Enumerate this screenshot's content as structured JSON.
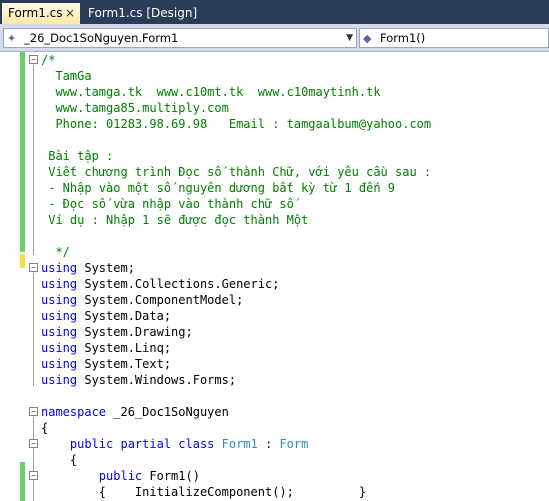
{
  "tabs": [
    {
      "label": "Form1.cs",
      "close": "×"
    },
    {
      "label": "Form1.cs [Design]"
    }
  ],
  "nav": {
    "left_combo": "_26_Doc1SoNguyen.Form1",
    "right_combo": "Form1()"
  },
  "code": {
    "comment": [
      "/*",
      "  TamGa",
      "  www.tamga.tk  www.c10mt.tk  www.c10maytinh.tk",
      "  www.tamga85.multiply.com",
      "  Phone: 01283.98.69.98   Email : tamgaalbum@yahoo.com",
      "",
      " Bài tập :",
      " Viết chương trình Đọc số thành Chữ, với yêu cầu sau :",
      " - Nhập vào một số nguyên dương bất kỳ từ 1 đến 9",
      " - Đọc số vừa nhập vào thành chữ số",
      " Ví dụ : Nhập 1 sẽ được đọc thành Một",
      "",
      "  */"
    ],
    "using_kw": "using",
    "usings": [
      " System;",
      " System.Collections.Generic;",
      " System.ComponentModel;",
      " System.Data;",
      " System.Drawing;",
      " System.Linq;",
      " System.Text;",
      " System.Windows.Forms;"
    ],
    "namespace_kw": "namespace",
    "namespace_name": " _26_Doc1SoNguyen",
    "open_brace": "{",
    "class_kw": "    public partial class",
    "class_name": " Form1",
    "class_sep": " : ",
    "class_base": "Form",
    "class_brace": "    {",
    "ctor_kw": "        public",
    "ctor_name": " Form1()",
    "ctor_body": "        {    InitializeComponent();         }"
  }
}
